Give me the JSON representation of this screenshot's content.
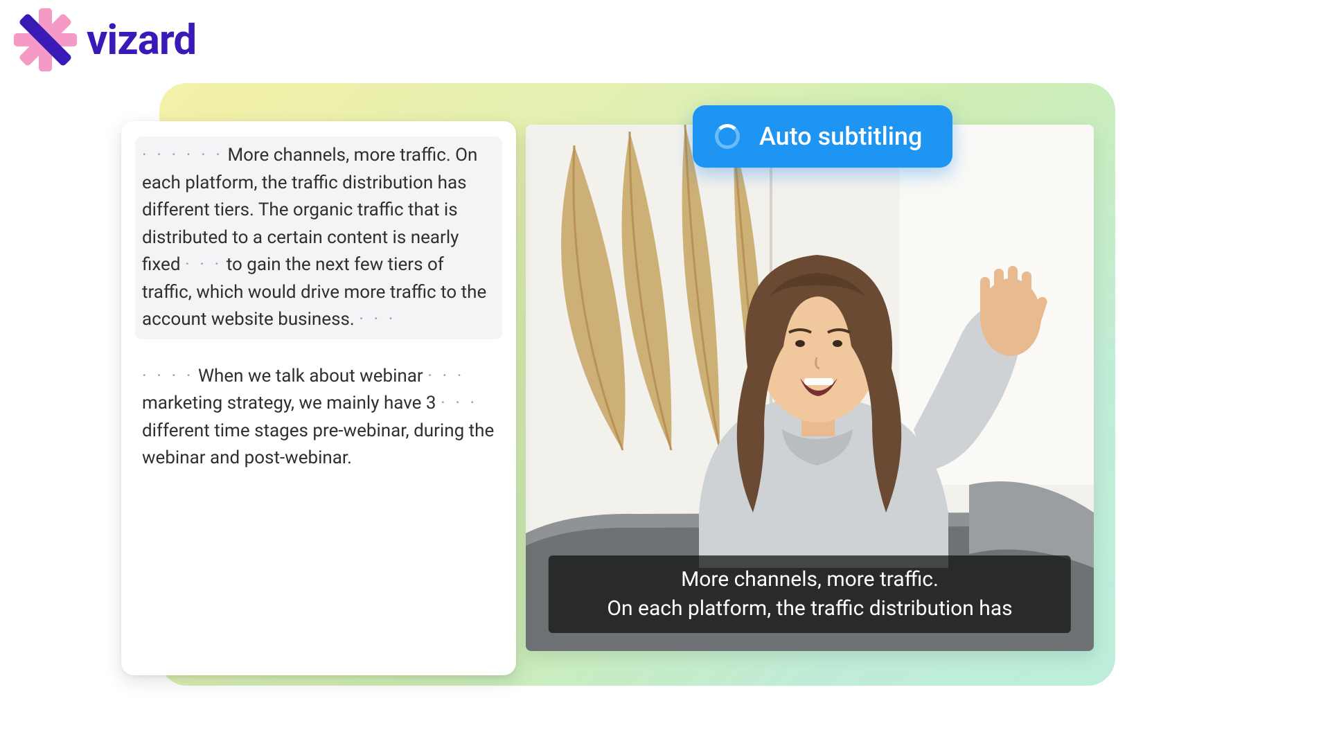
{
  "brand": {
    "name": "vizard",
    "logo_color_primary": "#f59ac7",
    "logo_color_secondary": "#3a1ab6",
    "text_color": "#3a1ab6"
  },
  "colors": {
    "pill_bg": "#1e95f3",
    "gradient_start": "#f5f1a8",
    "gradient_end": "#bceedb"
  },
  "pill": {
    "label": "Auto subtitling",
    "icon": "spinner-icon"
  },
  "transcript": {
    "paragraphs": [
      {
        "active": true,
        "chunks": [
          {
            "type": "dots",
            "count": 6
          },
          {
            "type": "text",
            "value": "More channels, more traffic. On each platform, the traffic distribution has different tiers. The organic traffic that is distributed to a certain content is nearly fixed"
          },
          {
            "type": "dots",
            "count": 3
          },
          {
            "type": "text",
            "value": "to gain the next few tiers of traffic, which would drive more traffic to the account website business."
          },
          {
            "type": "dots",
            "count": 3
          }
        ]
      },
      {
        "active": false,
        "chunks": [
          {
            "type": "dots",
            "count": 4
          },
          {
            "type": "text",
            "value": "When we talk about webinar"
          },
          {
            "type": "dots",
            "count": 3
          },
          {
            "type": "text",
            "value": "marketing strategy, we mainly have 3"
          },
          {
            "type": "dots",
            "count": 3
          },
          {
            "type": "text",
            "value": "different time stages pre-webinar, during the webinar and post-webinar."
          }
        ]
      }
    ]
  },
  "video": {
    "caption_line1": "More channels, more traffic.",
    "caption_line2": "On each platform, the traffic distribution has"
  }
}
